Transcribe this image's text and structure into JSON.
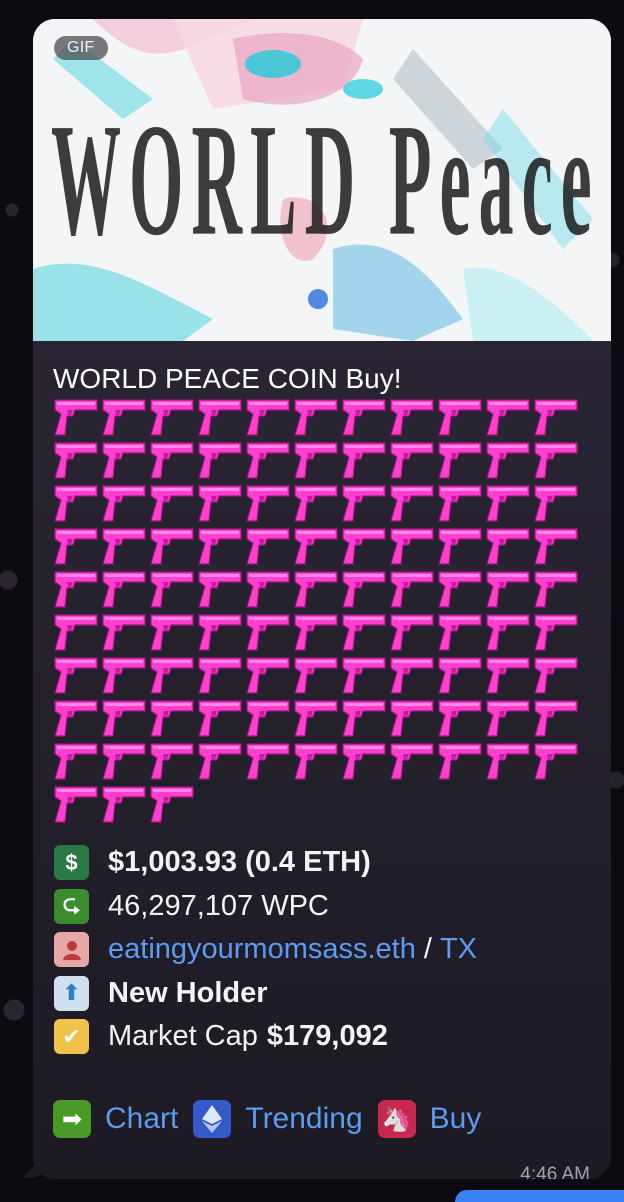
{
  "message": {
    "media_badge": "GIF",
    "media_caption": "WORLD Peace BUY",
    "title": "WORLD PEACE COIN Buy!",
    "emoji_name": "pistol",
    "emoji_count": 102,
    "info_rows": [
      {
        "icon": "dollar-icon",
        "text": "$1,003.93 (0.4 ETH)"
      },
      {
        "icon": "arrow-return-icon",
        "text": "46,297,107 WPC"
      },
      {
        "icon": "user-icon",
        "link": "eatingyourmomsass.eth",
        "sep": "/",
        "link2": "TX"
      },
      {
        "icon": "up-arrow-icon",
        "text": "New Holder"
      },
      {
        "icon": "checkmark-icon",
        "label": "Market Cap",
        "value": "$179,092"
      }
    ],
    "buttons": [
      {
        "icon": "right-arrow-icon",
        "label": "Chart"
      },
      {
        "icon": "ethereum-icon",
        "label": "Trending"
      },
      {
        "icon": "unicorn-icon",
        "label": "Buy"
      }
    ],
    "time": "4:46 AM"
  },
  "colors": {
    "link": "#5b9bf0",
    "gun": "#ff3fcf",
    "bubble": "#2a2432"
  }
}
